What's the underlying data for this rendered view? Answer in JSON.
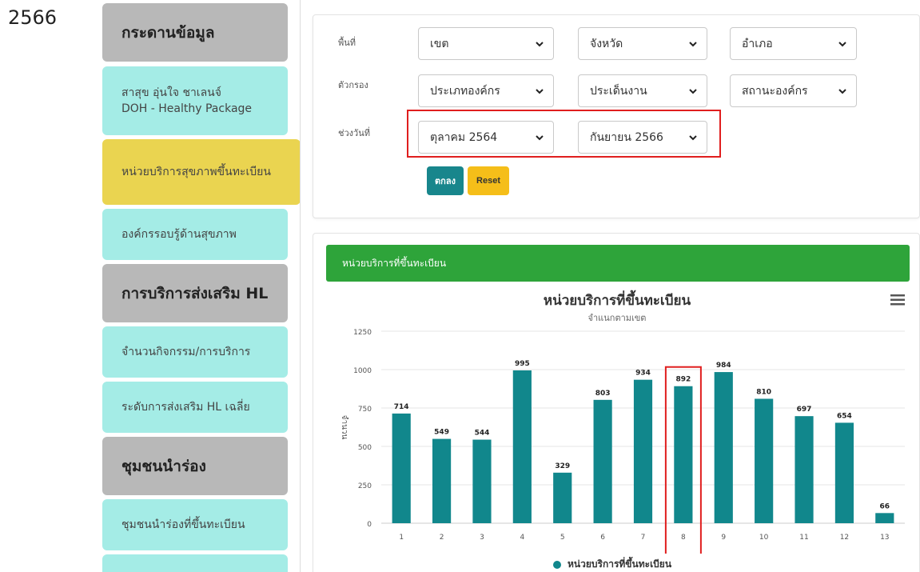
{
  "year_label": "2566",
  "sidebar": {
    "items": [
      {
        "type": "head",
        "label": "กระดานข้อมูล"
      },
      {
        "type": "cyan",
        "label": "สาสุข อุ่นใจ ชาเลนจ์",
        "label2": "DOH - Healthy Package"
      },
      {
        "type": "active",
        "label": "หน่วยบริการสุขภาพขึ้นทะเบียน"
      },
      {
        "type": "cyan",
        "label": "องค์กรรอบรู้ด้านสุขภาพ"
      },
      {
        "type": "head",
        "label": "การบริการส่งเสริม HL"
      },
      {
        "type": "cyan",
        "label": "จำนวนกิจกรรม/การบริการ"
      },
      {
        "type": "cyan",
        "label": "ระดับการส่งเสริม HL เฉลี่ย"
      },
      {
        "type": "head",
        "label": "ชุมชนนำร่อง"
      },
      {
        "type": "cyan",
        "label": "ชุมชนนำร่องที่ขึ้นทะเบียน"
      }
    ]
  },
  "filters": {
    "area_label": "พื้นที่",
    "filter_label": "ตัวกรอง",
    "date_label": "ช่วงวันที่",
    "zone": "เขต",
    "province": "จังหวัด",
    "district": "อำเภอ",
    "org_type": "ประเภทองค์กร",
    "work_issue": "ประเด็นงาน",
    "org_status": "สถานะองค์กร",
    "date_from": "ตุลาคม 2564",
    "date_to": "กันยายน 2566",
    "ok_label": "ตกลง",
    "reset_label": "Reset"
  },
  "colors": {
    "bar": "#11878c",
    "header_green": "#2ea43a",
    "highlight": "#e01e1e"
  },
  "chart_data": {
    "type": "bar",
    "header": "หน่วยบริการที่ขึ้นทะเบียน",
    "title": "หน่วยบริการที่ขึ้นทะเบียน",
    "subtitle": "จำแนกตามเขต",
    "ylabel": "จำนวน",
    "xlabel": "",
    "ylim": [
      0,
      1250
    ],
    "yticks": [
      0,
      250,
      500,
      750,
      1000,
      1250
    ],
    "grid": true,
    "legend_position": "bottom",
    "categories": [
      "1",
      "2",
      "3",
      "4",
      "5",
      "6",
      "7",
      "8",
      "9",
      "10",
      "11",
      "12",
      "13"
    ],
    "series": [
      {
        "name": "หน่วยบริการที่ขึ้นทะเบียน",
        "values": [
          714,
          549,
          544,
          995,
          329,
          803,
          934,
          892,
          984,
          810,
          697,
          654,
          66
        ]
      }
    ],
    "highlighted_category": "8"
  }
}
